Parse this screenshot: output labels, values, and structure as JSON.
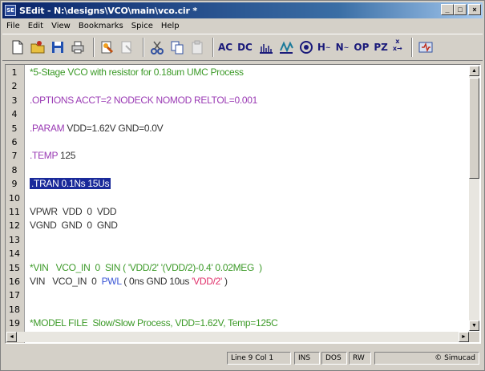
{
  "window": {
    "title": "SEdit - N:\\designs\\VCO\\main\\vco.cir *",
    "app_icon": "SE",
    "controls": {
      "minimize": "_",
      "maximize": "□",
      "close": "×"
    }
  },
  "menu": [
    "File",
    "Edit",
    "View",
    "Bookmarks",
    "Spice",
    "Help"
  ],
  "toolbar": {
    "file_icons": [
      "new-file-icon",
      "open-folder-icon",
      "save-icon",
      "print-icon"
    ],
    "edit_icons": [
      "find-icon",
      "replace-icon",
      "cut-icon",
      "copy-icon",
      "paste-icon"
    ],
    "analysis_buttons": [
      "AC",
      "DC",
      "OP",
      "PZ"
    ],
    "analysis_icons": [
      "noise-icon",
      "transient-icon",
      "sensitivity-icon",
      "harmonic-icon",
      "fourier-icon",
      "transfer-function-icon",
      "simulate-icon"
    ]
  },
  "editor": {
    "lines": [
      {
        "n": "1",
        "segments": [
          {
            "t": "*5-Stage VCO with resistor for 0.18um UMC Process",
            "c": "green"
          }
        ]
      },
      {
        "n": "2",
        "segments": []
      },
      {
        "n": "3",
        "segments": [
          {
            "t": ".OPTIONS ACCT=2 NODECK ",
            "c": "purple"
          },
          {
            "t": "NOMOD ",
            "c": "purple"
          },
          {
            "t": "RELTOL=0.001",
            "c": "purple"
          }
        ]
      },
      {
        "n": "4",
        "segments": []
      },
      {
        "n": "5",
        "segments": [
          {
            "t": ".PARAM ",
            "c": "purple"
          },
          {
            "t": "VDD=1.62V GND=0.0V",
            "c": "black"
          }
        ]
      },
      {
        "n": "6",
        "segments": []
      },
      {
        "n": "7",
        "segments": [
          {
            "t": ".TEMP ",
            "c": "purple"
          },
          {
            "t": "125",
            "c": "black"
          }
        ]
      },
      {
        "n": "8",
        "segments": []
      },
      {
        "n": "9",
        "segments": [
          {
            "t": ".TRAN 0.1Ns 15Us",
            "c": "highlight"
          }
        ]
      },
      {
        "n": "10",
        "segments": []
      },
      {
        "n": "11",
        "segments": [
          {
            "t": "VPWR  VDD  0  VDD",
            "c": "black"
          }
        ]
      },
      {
        "n": "12",
        "segments": [
          {
            "t": "VGND  GND  0  GND",
            "c": "black"
          }
        ]
      },
      {
        "n": "13",
        "segments": []
      },
      {
        "n": "14",
        "segments": []
      },
      {
        "n": "15",
        "segments": [
          {
            "t": "*VIN   VCO_IN  0  SIN ( 'VDD/2' '(VDD/2)-0.4' 0.02MEG  )",
            "c": "green"
          }
        ]
      },
      {
        "n": "16",
        "segments": [
          {
            "t": "VIN   VCO_IN  0  ",
            "c": "black"
          },
          {
            "t": "PWL",
            "c": "blue"
          },
          {
            "t": " ( 0ns GND 10us ",
            "c": "black"
          },
          {
            "t": "'VDD/2'",
            "c": "red"
          },
          {
            "t": " )",
            "c": "black"
          }
        ]
      },
      {
        "n": "17",
        "segments": []
      },
      {
        "n": "18",
        "segments": []
      },
      {
        "n": "19",
        "segments": [
          {
            "t": "*MODEL FILE  Slow/Slow Process, VDD=1.62V, Temp=125C",
            "c": "green"
          }
        ]
      }
    ]
  },
  "statusbar": {
    "position": "Line 9 Col 1",
    "ins": "INS",
    "format": "DOS",
    "mode": "RW",
    "brand": "© Simucad"
  }
}
